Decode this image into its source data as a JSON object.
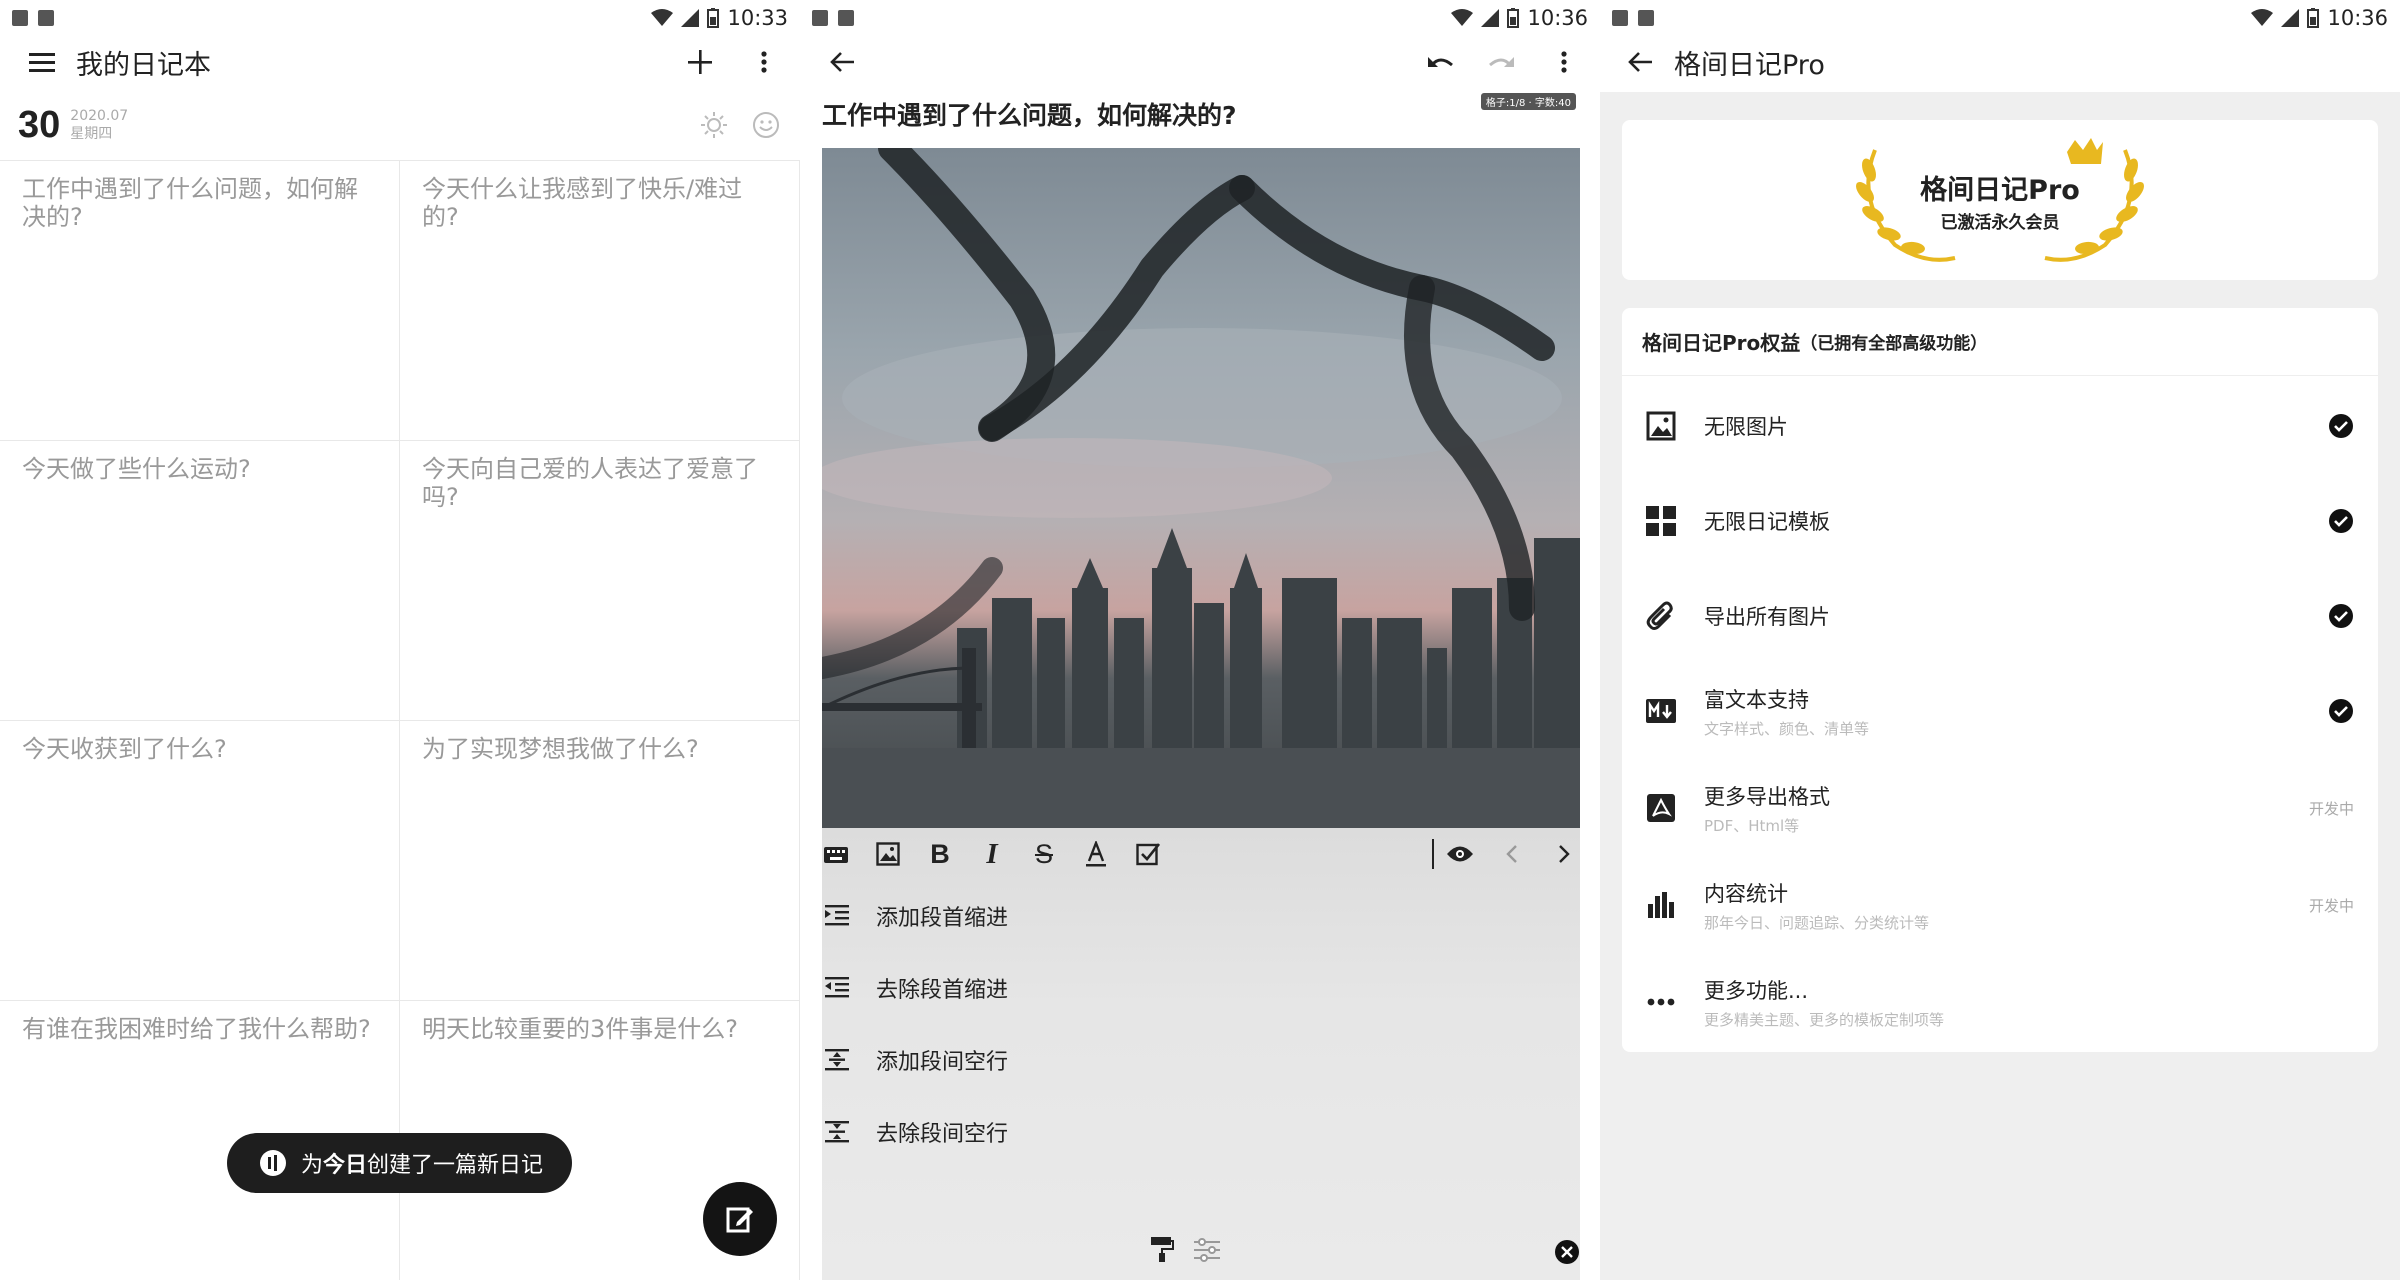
{
  "status1": {
    "time": "10:33"
  },
  "status2": {
    "time": "10:36"
  },
  "status3": {
    "time": "10:36"
  },
  "diary": {
    "title": "我的日记本",
    "date": {
      "day": "30",
      "year_month": "2020.07",
      "weekday": "星期四"
    },
    "prompts": [
      "工作中遇到了什么问题，如何解决的?",
      "今天什么让我感到了快乐/难过的?",
      "今天做了些什么运动?",
      "今天向自己爱的人表达了爱意了吗?",
      "今天收获到了什么?",
      "为了实现梦想我做了什么?",
      "有谁在我困难时给了我什么帮助?",
      "明天比较重要的3件事是什么?"
    ],
    "toast": {
      "prefix": "为",
      "bold": "今日",
      "suffix": "创建了一篇新日记"
    }
  },
  "editor": {
    "question": "工作中遇到了什么问题，如何解决的?",
    "counter": "格子:1/8 · 字数:40",
    "menu": [
      "添加段首缩进",
      "去除段首缩进",
      "添加段间空行",
      "去除段间空行"
    ]
  },
  "pro": {
    "title": "格间日记Pro",
    "hero_title": "格间日记Pro",
    "hero_sub": "已激活永久会员",
    "list_title": "格间日记Pro权益",
    "list_note": "（已拥有全部高级功能）",
    "features": [
      {
        "name": "无限图片",
        "desc": "",
        "status": "check",
        "icon": "image-icon"
      },
      {
        "name": "无限日记模板",
        "desc": "",
        "status": "check",
        "icon": "grid-icon"
      },
      {
        "name": "导出所有图片",
        "desc": "",
        "status": "check",
        "icon": "paperclip-icon"
      },
      {
        "name": "富文本支持",
        "desc": "文字样式、颜色、清单等",
        "status": "check",
        "icon": "markdown-icon"
      },
      {
        "name": "更多导出格式",
        "desc": "PDF、Html等",
        "status": "开发中",
        "icon": "pdf-icon"
      },
      {
        "name": "内容统计",
        "desc": "那年今日、问题追踪、分类统计等",
        "status": "开发中",
        "icon": "bar-chart-icon"
      },
      {
        "name": "更多功能...",
        "desc": "更多精美主题、更多的模板定制项等",
        "status": "",
        "icon": "more-dots-icon"
      }
    ]
  }
}
